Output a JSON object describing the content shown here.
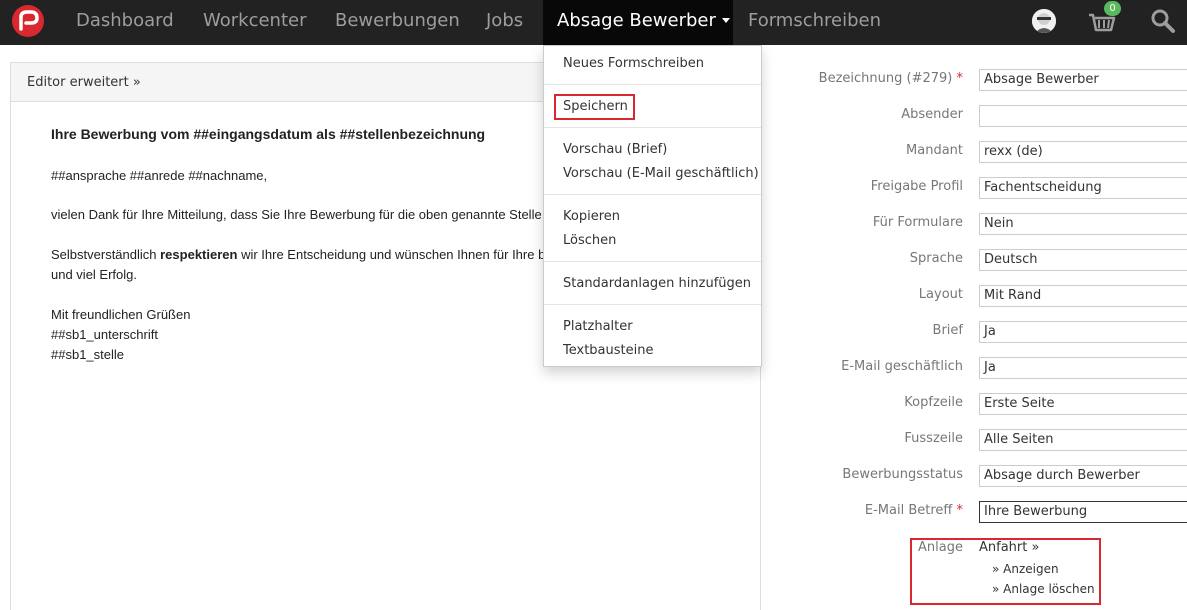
{
  "nav": {
    "items": [
      "Dashboard",
      "Workcenter",
      "Bewerbungen",
      "Jobs"
    ],
    "active": "Absage Bewerber",
    "after": "Formschreiben",
    "cart_count": "0",
    "icons": [
      "logo-icon",
      "avatar",
      "cart-icon",
      "search-icon"
    ]
  },
  "editor": {
    "toggle_label": "Editor erweitert »",
    "heading": "Ihre Bewerbung vom ##eingangsdatum als ##stellenbezeichnung",
    "salutation": "##ansprache ##anrede ##nachname,",
    "para1": "vielen Dank für Ihre Mitteilung, dass Sie Ihre Bewerbung für die oben genannte Stelle",
    "para2_pre": "Selbstverständlich ",
    "para2_bold": "respektieren",
    "para2_post": " wir Ihre Entscheidung und wünschen Ihnen für Ihre b",
    "para2_line2": "und viel Erfolg.",
    "closing": "Mit freundlichen Grüßen",
    "sign1": "##sb1_unterschrift",
    "sign2": "##sb1_stelle"
  },
  "dropdown": {
    "new": "Neues Formschreiben",
    "save": "Speichern",
    "preview_letter": "Vorschau (Brief)",
    "preview_email": "Vorschau (E-Mail geschäftlich)",
    "copy": "Kopieren",
    "delete": "Löschen",
    "add_attachments": "Standardanlagen hinzufügen",
    "placeholders": "Platzhalter",
    "text_blocks": "Textbausteine"
  },
  "form": {
    "fields": [
      {
        "label": "Bezeichnung (#279)",
        "required": true,
        "value": "Absage Bewerber"
      },
      {
        "label": "Absender",
        "required": false,
        "value": ""
      },
      {
        "label": "Mandant",
        "required": false,
        "value": "rexx (de)"
      },
      {
        "label": "Freigabe Profil",
        "required": false,
        "value": "Fachentscheidung"
      },
      {
        "label": "Für Formulare",
        "required": false,
        "value": "Nein"
      },
      {
        "label": "Sprache",
        "required": false,
        "value": "Deutsch"
      },
      {
        "label": "Layout",
        "required": false,
        "value": "Mit Rand"
      },
      {
        "label": "Brief",
        "required": false,
        "value": "Ja"
      },
      {
        "label": "E-Mail geschäftlich",
        "required": false,
        "value": "Ja"
      },
      {
        "label": "Kopfzeile",
        "required": false,
        "value": "Erste Seite"
      },
      {
        "label": "Fusszeile",
        "required": false,
        "value": "Alle Seiten"
      },
      {
        "label": "Bewerbungsstatus",
        "required": false,
        "value": "Absage durch Bewerber"
      },
      {
        "label": "E-Mail Betreff",
        "required": true,
        "value": "Ihre Bewerbung"
      }
    ],
    "required_mark": "*",
    "anlage_label": "Anlage",
    "anlage_name": "Anfahrt »",
    "anlage_show": "» Anzeigen",
    "anlage_delete": "» Anlage löschen"
  },
  "colors": {
    "nav_bg": "#222222",
    "active_bg": "#080808",
    "accent": "#d9282f",
    "badge": "#5cb85c"
  }
}
